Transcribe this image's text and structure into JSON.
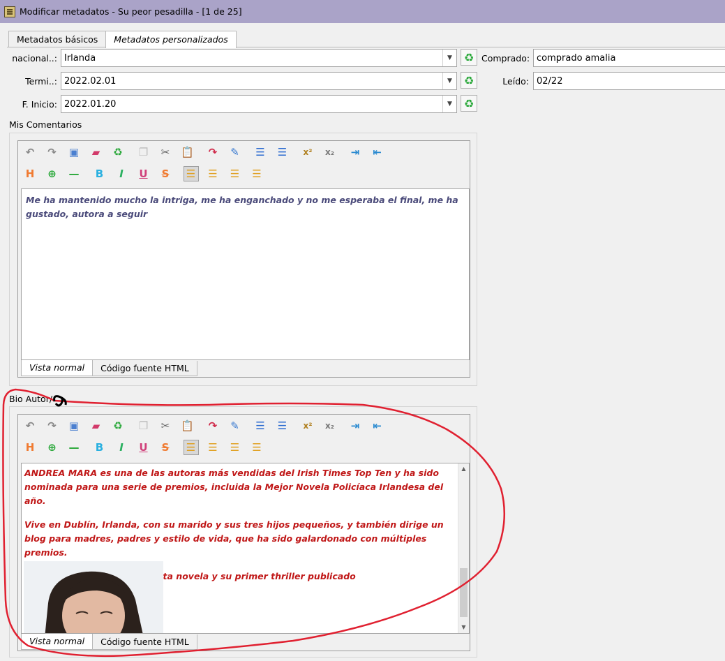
{
  "window": {
    "title": "Modificar metadatos - Su peor pesadilla -  [1 de 25]"
  },
  "tabs": [
    {
      "label": "Metadatos básicos"
    },
    {
      "label": "Metadatos personalizados"
    }
  ],
  "fields": {
    "nacional": {
      "label": "nacional..:",
      "value": "Irlanda"
    },
    "termi": {
      "label": "Termi..:",
      "value": "2022.02.01"
    },
    "finicio": {
      "label": "F. Inicio:",
      "value": "2022.01.20"
    },
    "comprado": {
      "label": "Comprado:",
      "value": "comprado amalia"
    },
    "leido": {
      "label": "Leído:",
      "value": "02/22"
    }
  },
  "comments": {
    "label": "Mis Comentarios",
    "text": "Me ha mantenido mucho la intriga, me ha enganchado y no me esperaba el final, me ha gustado, autora a seguir",
    "text_color": "#4a4a7a",
    "view_tabs": [
      "Vista normal",
      "Código fuente HTML"
    ]
  },
  "bio": {
    "label": "Bio Autor/",
    "paragraphs": [
      "ANDREA MARA es una de las autoras más vendidas del Irish Times Top Ten y ha sido nominada para una serie de premios, incluida la Mejor Novela Policíaca Irlandesa del año.",
      "Vive en Dublín, Irlanda, con su marido y sus tres hijos pequeños, y también dirige un blog para madres, padres y estilo de vida, que ha sido galardonado con múltiples premios.",
      "Su peor pesadilla es su cuarta novela y su primer thriller publicado internacionalmente."
    ],
    "text_color": "#c01818",
    "view_tabs": [
      "Vista normal",
      "Código fuente HTML"
    ]
  },
  "toolbar": {
    "row1": [
      "undo-icon",
      "redo-icon",
      "select-all-icon",
      "eraser-icon",
      "recycle-icon",
      "copy-icon",
      "cut-icon",
      "paste-icon",
      "link-icon",
      "brush-icon",
      "ordered-list-icon",
      "unordered-list-icon",
      "superscript-icon",
      "subscript-icon",
      "indent-icon",
      "outdent-icon"
    ],
    "row2": [
      "heading-icon",
      "horizontal-rule-plus-icon",
      "horizontal-rule-icon",
      "bold-icon",
      "italic-icon",
      "underline-icon",
      "strikethrough-icon",
      "align-left-icon",
      "align-center-icon",
      "align-right-icon",
      "align-justify-icon"
    ],
    "glyphs": {
      "bold": "B",
      "italic": "I",
      "underline": "U",
      "strike": "S",
      "heading": "H"
    }
  },
  "annotation_color": "#e02030"
}
